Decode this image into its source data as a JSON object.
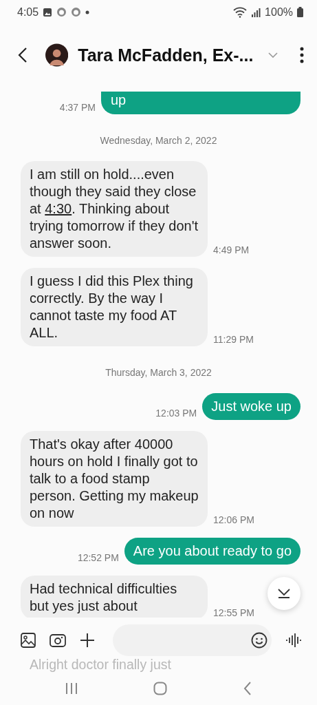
{
  "status_bar": {
    "time": "4:05",
    "battery": "100%"
  },
  "header": {
    "title": "Tara McFadden, Ex-..."
  },
  "messages": [
    {
      "kind": "sent",
      "parts": [
        {
          "text": "up"
        }
      ],
      "time": "4:37 PM",
      "cut_top": true
    },
    {
      "kind": "date",
      "text": "Wednesday, March 2, 2022"
    },
    {
      "kind": "received",
      "parts": [
        {
          "text": "I am still on hold....even though they said they close at "
        },
        {
          "text": "4:30",
          "link": true
        },
        {
          "text": ". Thinking about trying tomorrow if they don't answer soon."
        }
      ],
      "time": "4:49 PM"
    },
    {
      "kind": "received",
      "parts": [
        {
          "text": "I guess I did this Plex thing correctly. By the way I cannot taste my food AT ALL."
        }
      ],
      "time": "11:29 PM"
    },
    {
      "kind": "date",
      "text": "Thursday, March 3, 2022"
    },
    {
      "kind": "sent",
      "parts": [
        {
          "text": "Just woke up"
        }
      ],
      "time": "12:03 PM"
    },
    {
      "kind": "received",
      "parts": [
        {
          "text": "That's okay after 40000 hours on hold I finally got to talk to a food stamp person. Getting my makeup on now"
        }
      ],
      "time": "12:06 PM"
    },
    {
      "kind": "sent",
      "parts": [
        {
          "text": "Are you about ready to go"
        }
      ],
      "time": "12:52 PM"
    },
    {
      "kind": "received",
      "parts": [
        {
          "text": "Had technical difficulties but yes just about"
        }
      ],
      "time": "12:55 PM"
    }
  ],
  "ghost_text": "Alright doctor finally just"
}
